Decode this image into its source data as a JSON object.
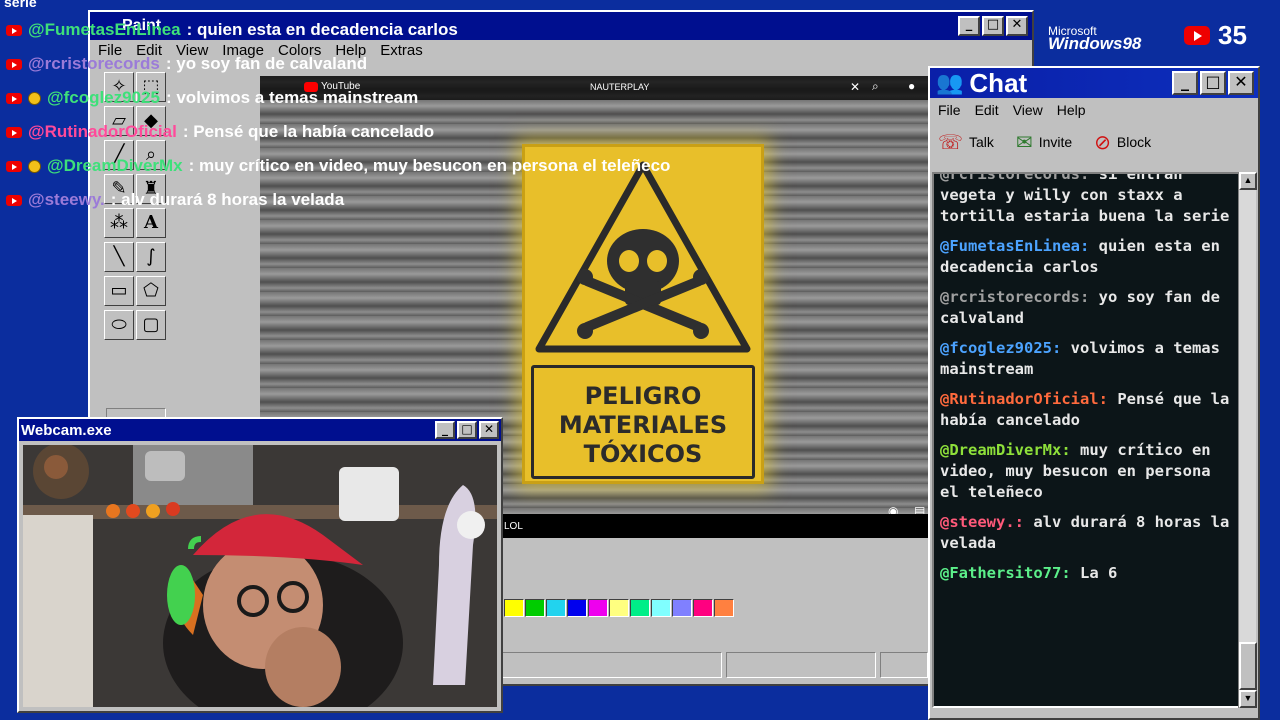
{
  "corner_text": "serie",
  "paint": {
    "title": "Paint",
    "menu": [
      "File",
      "Edit",
      "View",
      "Image",
      "Colors",
      "Help",
      "Extras"
    ],
    "palette": [
      "#ffff00",
      "#00cc00",
      "#22d3ee",
      "#0000ee",
      "#ee00ee",
      "#ffff80",
      "#00ee88",
      "#80ffff",
      "#8080ff",
      "#ff0080",
      "#ff8040"
    ]
  },
  "youtube": {
    "logo_text": "YouTube",
    "search_text": "NAUTERPLAY",
    "sign_lines": [
      "PELIGRO",
      "MATERIALES",
      "TÓXICOS"
    ],
    "bottom_text": "LOL"
  },
  "chat": {
    "title": "Chat",
    "menu": [
      "File",
      "Edit",
      "View",
      "Help"
    ],
    "toolbar": [
      "Talk",
      "Invite",
      "Block"
    ],
    "messages": [
      {
        "user": "@rcristorecords:",
        "text": " si entran vegeta y willy con staxx a tortilla estaria buena la serie",
        "color": "#a0a0a0"
      },
      {
        "user": "@FumetasEnLinea:",
        "text": " quien esta en decadencia carlos",
        "color": "#4ca3ff"
      },
      {
        "user": "@rcristorecords:",
        "text": " yo soy fan de calvaland",
        "color": "#a0a0a0"
      },
      {
        "user": "@fcoglez9025:",
        "text": " volvimos a temas mainstream",
        "color": "#4ca3ff"
      },
      {
        "user": "@RutinadorOficial:",
        "text": " Pensé que la había cancelado",
        "color": "#ff6a3d"
      },
      {
        "user": "@DreamDiverMx:",
        "text": " muy crítico en video, muy besucon en persona el teleñeco",
        "color": "#8ee03a"
      },
      {
        "user": "@steewy.:",
        "text": " alv durará 8 horas la velada",
        "color": "#ff5a7a"
      },
      {
        "user": "@Fathersito77:",
        "text": " La 6",
        "color": "#5cf08a"
      }
    ]
  },
  "webcam": {
    "title": "Webcam.exe"
  },
  "overlay": [
    {
      "user": "@FumetasEnLinea",
      "text": ": quien esta en decadencia carlos",
      "color": "#3ee07a",
      "star": false
    },
    {
      "user": "@rcristorecords",
      "text": ": yo soy fan de calvaland",
      "color": "#9b7bd8",
      "star": false
    },
    {
      "user": "@fcoglez9025",
      "text": ": volvimos a temas mainstream",
      "color": "#3ee07a",
      "star": true
    },
    {
      "user": "@RutinadorOficial",
      "text": ": Pensé que la había cancelado",
      "color": "#ff4a9a",
      "star": false
    },
    {
      "user": "@DreamDiverMx",
      "text": ": muy crítico en video, muy besucon en persona el teleñeco",
      "color": "#3ee07a",
      "star": true
    },
    {
      "user": "@steewy.",
      "text": ": alv durará 8 horas la velada",
      "color": "#9b7bd8",
      "star": false
    }
  ],
  "branding": {
    "microsoft": "Microsoft",
    "windows": "Windows98",
    "sub_count": "35"
  }
}
